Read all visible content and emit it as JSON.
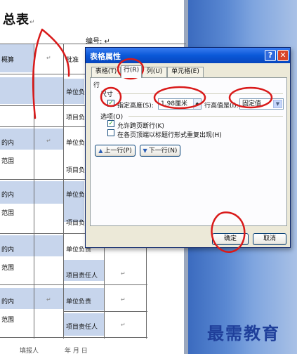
{
  "document": {
    "title": "总表",
    "paragraph_mark": "↵",
    "serial_label": "编号: ↵",
    "rows": {
      "r1_left": "概算",
      "r1_right": "批准",
      "unit_label": "单位负责",
      "proj_label": "项目负责人",
      "content_label": "的内",
      "scope_label": "范围",
      "proj_resp_label": "项目责任人",
      "footer_left": "填报人",
      "footer_mid": "年  月  日"
    }
  },
  "dialog": {
    "title": "表格属性",
    "help_symbol": "?",
    "close_symbol": "✕",
    "tabs": [
      {
        "label": "表格(T)"
      },
      {
        "label": "行(R)"
      },
      {
        "label": "列(U)"
      },
      {
        "label": "单元格(E)"
      }
    ],
    "section_row": "行",
    "size_label": "尺寸",
    "specify_height_label": "指定高度(S):",
    "specify_height_checked": true,
    "height_value": "1.98厘米",
    "row_height_is_label": "行高值是(I):",
    "row_height_mode": "固定值",
    "options_label": "选项(O)",
    "allow_break_label": "允许跨页断行(K)",
    "allow_break_checked": true,
    "repeat_header_label": "在各页顶端以标题行形式重复出现(H)",
    "repeat_header_checked": false,
    "prev_row_label": "上一行(P)",
    "next_row_label": "下一行(N)",
    "ok_label": "确定",
    "cancel_label": "取消"
  },
  "watermark": "最需教育",
  "colors": {
    "titlebar": "#0a58d8",
    "dialog_bg": "#ece9d8",
    "cell_blue": "#c7d5ec",
    "annotation_red": "#d91a1a",
    "watermark": "#1f3f9a"
  }
}
